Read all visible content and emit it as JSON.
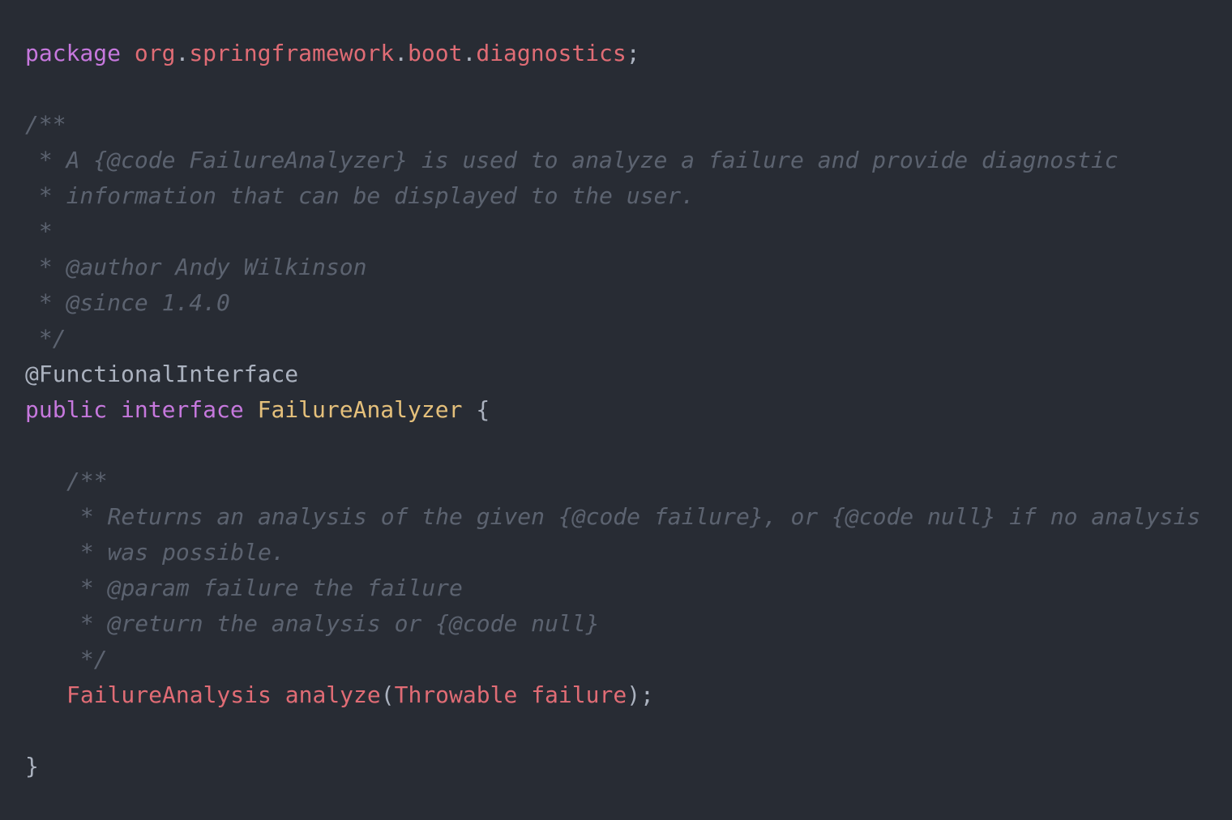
{
  "file": {
    "package_kw": "package",
    "package_parts": [
      "org",
      "springframework",
      "boot",
      "diagnostics"
    ],
    "package_end": ";",
    "class_doc": [
      "/**",
      " * A {@code FailureAnalyzer} is used to analyze a failure and provide diagnostic",
      " * information that can be displayed to the user.",
      " *",
      " * @author Andy Wilkinson",
      " * @since 1.4.0",
      " */"
    ],
    "annotation": "@FunctionalInterface",
    "decl": {
      "public_kw": "public",
      "interface_kw": "interface",
      "name": "FailureAnalyzer",
      "open_brace": "{"
    },
    "method_doc": [
      "/**",
      " * Returns an analysis of the given {@code failure}, or {@code null} if no analysis",
      " * was possible.",
      " * @param failure the failure",
      " * @return the analysis or {@code null}",
      " */"
    ],
    "method": {
      "return_type": "FailureAnalysis",
      "name": "analyze",
      "open_paren": "(",
      "param_type": "Throwable",
      "param_name": "failure",
      "close": ");"
    },
    "close_brace": "}"
  },
  "colors": {
    "background": "#282c34",
    "keyword": "#c678dd",
    "identifier_red": "#e06c75",
    "type_yellow": "#e5c07b",
    "comment": "#5c6370",
    "text": "#abb2bf"
  }
}
